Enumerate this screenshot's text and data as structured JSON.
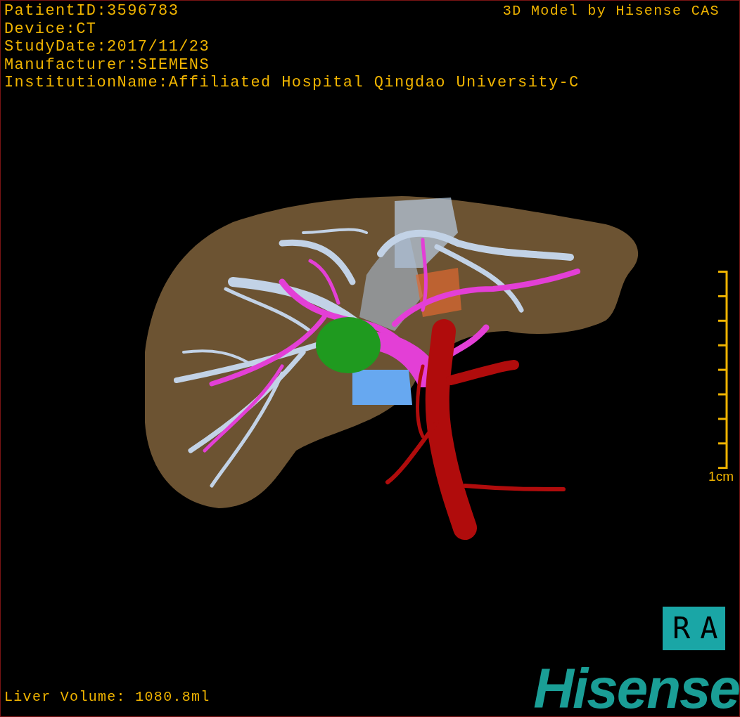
{
  "header_lines": [
    "PatientID:3596783",
    "Device:CT",
    "StudyDate:2017/11/23",
    "Manufacturer:SIEMENS",
    "InstitutionName:Affiliated Hospital Qingdao University-C"
  ],
  "title": "3D Model by Hisense CAS",
  "scale_bar": {
    "label": "1cm"
  },
  "volume": "Liver Volume: 1080.8ml",
  "orientation": "RA",
  "logo": "Hisense"
}
